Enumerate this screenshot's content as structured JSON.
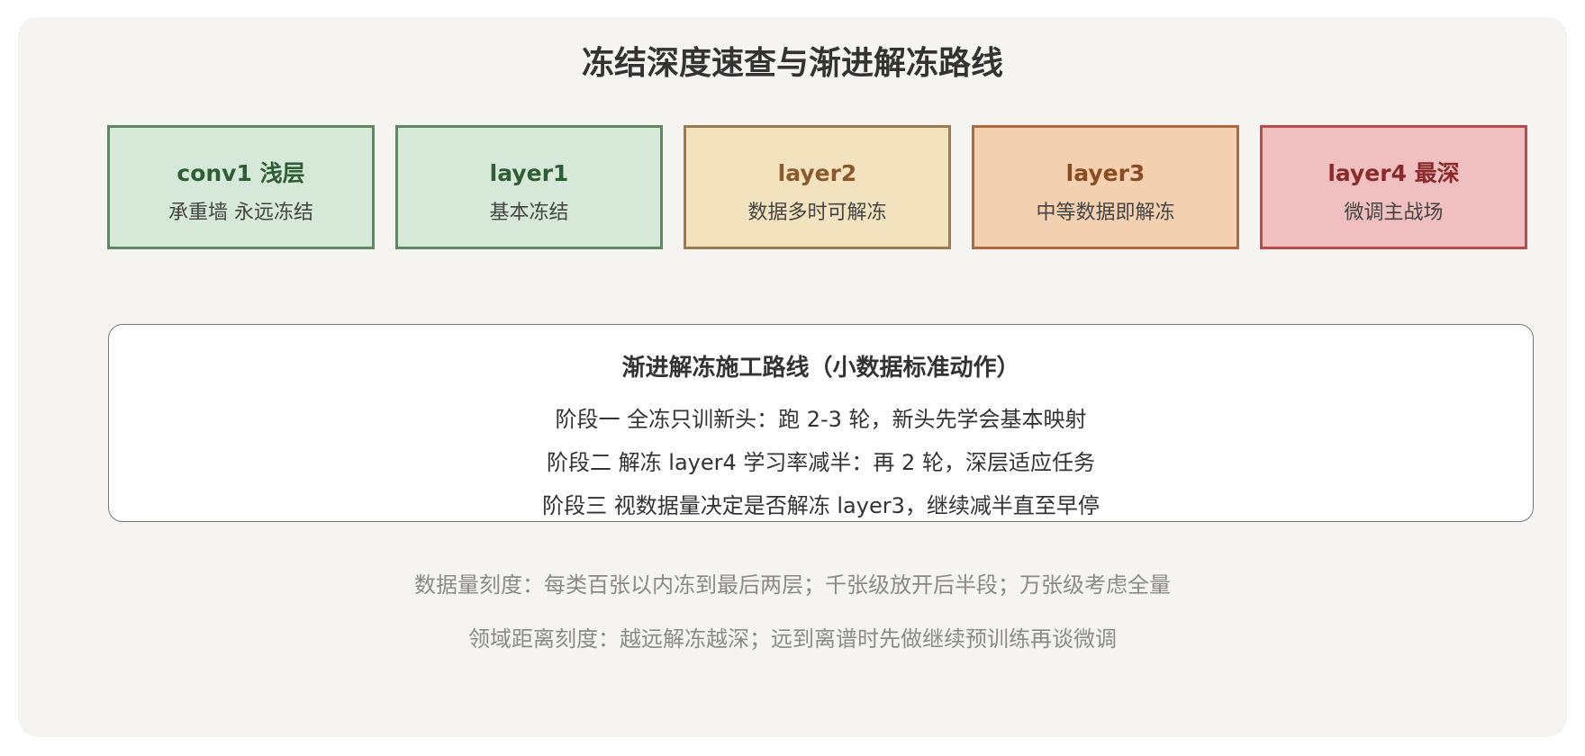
{
  "title": "冻结深度速查与渐进解冻路线",
  "layers": [
    {
      "name": "conv1 浅层",
      "desc": "承重墙 永远冻结",
      "fill": "#d6e8d7",
      "border": "#5a8a5e",
      "text": "#2f5e34"
    },
    {
      "name": "layer1",
      "desc": "基本冻结",
      "fill": "#d6e8d7",
      "border": "#5a8a5e",
      "text": "#2f5e34"
    },
    {
      "name": "layer2",
      "desc": "数据多时可解冻",
      "fill": "#f2e2bd",
      "border": "#a07a4c",
      "text": "#8a5a2c"
    },
    {
      "name": "layer3",
      "desc": "中等数据即解冻",
      "fill": "#f2d0b0",
      "border": "#b0693e",
      "text": "#8a4a22"
    },
    {
      "name": "layer4 最深",
      "desc": "微调主战场",
      "fill": "#f0c0c0",
      "border": "#b84c4c",
      "text": "#8a2a2a"
    }
  ],
  "route": {
    "title": "渐进解冻施工路线（小数据标准动作）",
    "steps": [
      "阶段一 全冻只训新头：跑 2-3 轮，新头先学会基本映射",
      "阶段二 解冻 layer4 学习率减半：再 2 轮，深层适应任务",
      "阶段三 视数据量决定是否解冻 layer3，继续减半直至早停"
    ]
  },
  "notes": [
    "数据量刻度：每类百张以内冻到最后两层；千张级放开后半段；万张级考虑全量",
    "领域距离刻度：越远解冻越深；远到离谱时先做继续预训练再谈微调"
  ]
}
